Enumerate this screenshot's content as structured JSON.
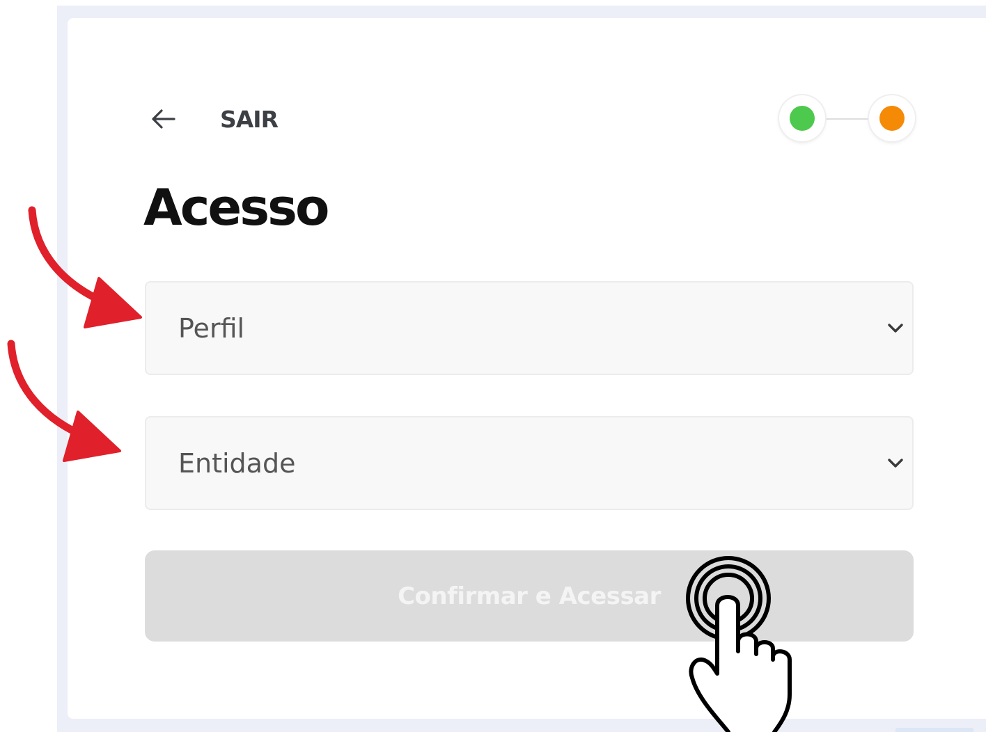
{
  "header": {
    "back_label": "SAIR"
  },
  "stepper": {
    "steps": [
      {
        "status": "complete",
        "color": "#4dc94d"
      },
      {
        "status": "current",
        "color": "#f58a07"
      }
    ]
  },
  "page": {
    "title": "Acesso"
  },
  "form": {
    "perfil": {
      "value": "Perfil"
    },
    "entidade": {
      "value": "Entidade"
    },
    "submit_label": "Confirmar e Acessar",
    "submit_enabled": false
  },
  "annotations": {
    "arrow_color": "#e0202a",
    "arrow_icon": "curved-arrow-icon",
    "tap_icon": "tap-gesture-icon"
  },
  "theme": {
    "backdrop": "#eceef8",
    "card": "#ffffff",
    "field_bg": "#f8f8f8",
    "button_disabled_bg": "#dcdcdc"
  }
}
